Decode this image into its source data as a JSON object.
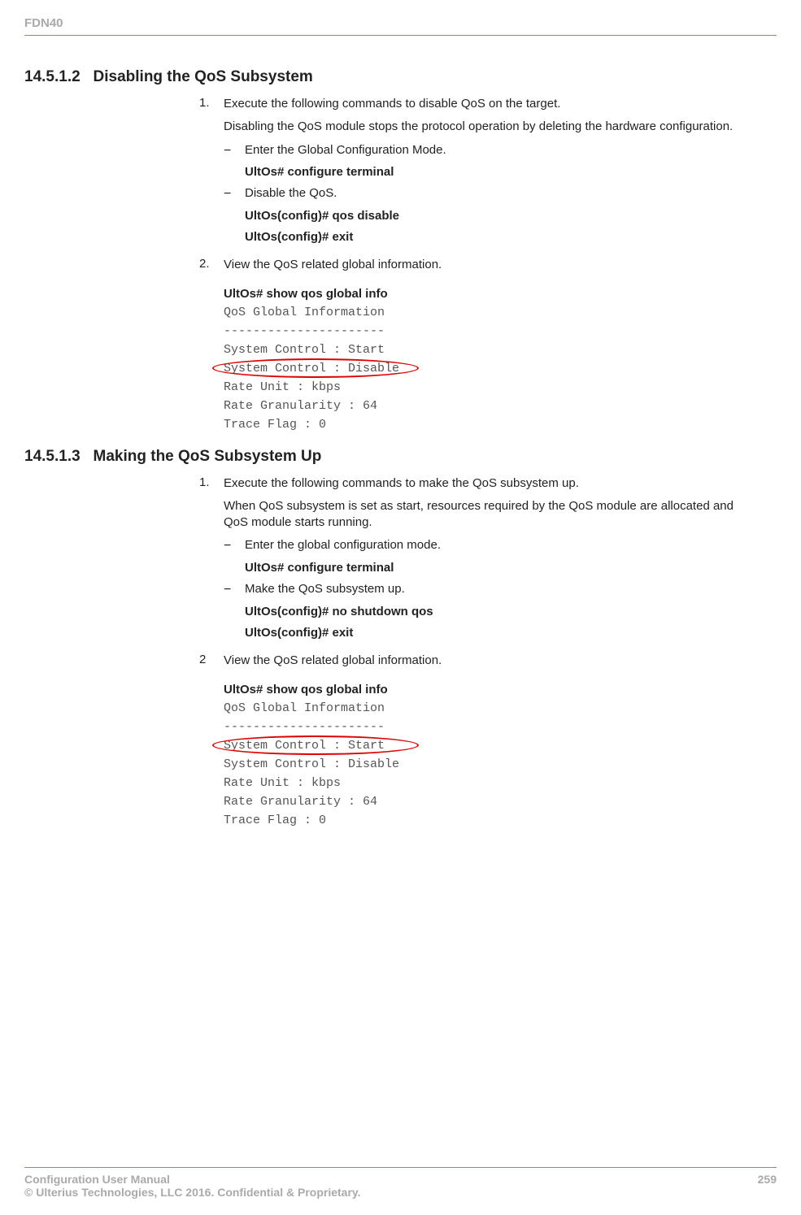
{
  "header": {
    "doc_id": "FDN40"
  },
  "section1": {
    "number": "14.5.1.2",
    "title": "Disabling the QoS Subsystem",
    "step1": {
      "num": "1.",
      "text": "Execute the following commands to disable QoS on the target.",
      "desc": "Disabling the QoS module stops the protocol operation by deleting the hardware configuration.",
      "sub1": "Enter the Global Configuration Mode.",
      "cmd1": "UltOs# configure terminal",
      "sub2": "Disable the QoS.",
      "cmd2": "UltOs(config)# qos disable",
      "cmd3": "UltOs(config)# exit"
    },
    "step2": {
      "num": "2.",
      "text": "View the QoS related global information.",
      "cmd": "UltOs# show qos global info",
      "out1": "QoS Global Information",
      "out2": "----------------------",
      "out3": "System Control : Start",
      "out4": "System Control : Disable",
      "out5": "Rate Unit : kbps",
      "out6": "Rate Granularity : 64",
      "out7": "Trace Flag : 0"
    }
  },
  "section2": {
    "number": "14.5.1.3",
    "title": "Making the QoS Subsystem Up",
    "step1": {
      "num": "1.",
      "text": "Execute the following commands to make the QoS subsystem up.",
      "desc": "When QoS subsystem is set as start, resources required by the QoS module are allocated and QoS module starts running.",
      "sub1": "Enter the global configuration mode.",
      "cmd1": "UltOs# configure terminal",
      "sub2": "Make the QoS subsystem up.",
      "cmd2": "UltOs(config)# no shutdown qos",
      "cmd3": "UltOs(config)# exit"
    },
    "step2": {
      "num": "2",
      "text": "View the QoS related global information.",
      "cmd": "UltOs# show qos global info",
      "out1": "QoS Global Information",
      "out2": "----------------------",
      "out3": "System Control : Start",
      "out4": "System Control : Disable",
      "out5": "Rate Unit : kbps",
      "out6": "Rate Granularity : 64",
      "out7": "Trace Flag : 0"
    }
  },
  "footer": {
    "left1": "Configuration User Manual",
    "left2": "© Ulterius Technologies, LLC 2016. Confidential & Proprietary.",
    "page": "259"
  }
}
